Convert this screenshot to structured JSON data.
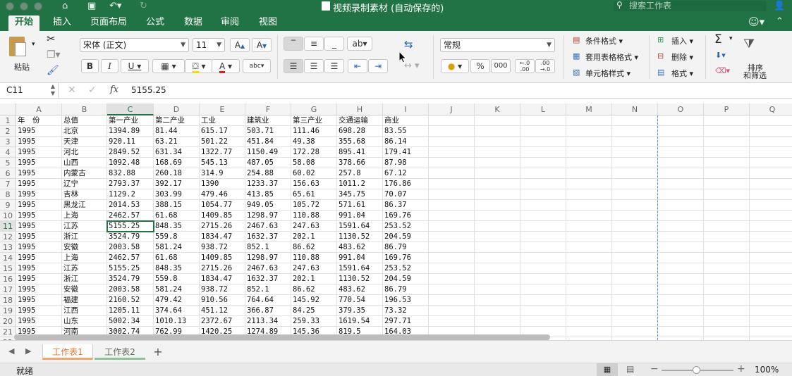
{
  "titlebar": {
    "title": "视频录制素材 (自动保存的)",
    "search_placeholder": "搜索工作表"
  },
  "ribbon_tabs": [
    "开始",
    "插入",
    "页面布局",
    "公式",
    "数据",
    "审阅",
    "视图"
  ],
  "active_tab": "开始",
  "ribbon": {
    "paste_label": "粘贴",
    "font_name": "宋体 (正文)",
    "font_size": "11",
    "bold": "B",
    "italic": "I",
    "underline": "U",
    "number_format": "常规",
    "percent": "%",
    "thousands": "000",
    "inc_decimal": "←.0 .00",
    "dec_decimal": ".00 →.0",
    "conditional_format": "条件格式",
    "format_as_table": "套用表格格式",
    "cell_styles": "单元格样式",
    "insert": "插入",
    "delete": "删除",
    "format": "格式",
    "sort_filter": "排序\n和筛选",
    "sort_filter_line1": "排序",
    "sort_filter_line2": "和筛选"
  },
  "formula_bar": {
    "name_box": "C11",
    "fx": "fx",
    "value": "5155.25"
  },
  "columns": [
    "A",
    "B",
    "C",
    "D",
    "E",
    "F",
    "G",
    "H",
    "I",
    "J",
    "K",
    "L",
    "M",
    "N",
    "O",
    "P",
    "Q"
  ],
  "selected_column": "C",
  "selected_row": 11,
  "header_row": [
    "年　份",
    "总值",
    "第一产业",
    "第二产业",
    "工业",
    "建筑业",
    "第三产业",
    "交通运输",
    "商业"
  ],
  "rows": [
    [
      "1995",
      "北京",
      "1394.89",
      "81.44",
      "615.17",
      "503.71",
      "111.46",
      "698.28",
      "83.55"
    ],
    [
      "1995",
      "天津",
      "920.11",
      "63.21",
      "501.22",
      "451.84",
      "49.38",
      "355.68",
      "86.14"
    ],
    [
      "1995",
      "河北",
      "2849.52",
      "631.34",
      "1322.77",
      "1150.49",
      "172.28",
      "895.41",
      "179.41"
    ],
    [
      "1995",
      "山西",
      "1092.48",
      "168.69",
      "545.13",
      "487.05",
      "58.08",
      "378.66",
      "87.98"
    ],
    [
      "1995",
      "内蒙古",
      "832.88",
      "260.18",
      "314.9",
      "254.88",
      "60.02",
      "257.8",
      "67.12"
    ],
    [
      "1995",
      "辽宁",
      "2793.37",
      "392.17",
      "1390",
      "1233.37",
      "156.63",
      "1011.2",
      "176.86"
    ],
    [
      "1995",
      "吉林",
      "1129.2",
      "303.99",
      "479.46",
      "413.85",
      "65.61",
      "345.75",
      "70.07"
    ],
    [
      "1995",
      "黑龙江",
      "2014.53",
      "388.15",
      "1054.77",
      "949.05",
      "105.72",
      "571.61",
      "86.37"
    ],
    [
      "1995",
      "上海",
      "2462.57",
      "61.68",
      "1409.85",
      "1298.97",
      "110.88",
      "991.04",
      "169.76"
    ],
    [
      "1995",
      "江苏",
      "5155.25",
      "848.35",
      "2715.26",
      "2467.63",
      "247.63",
      "1591.64",
      "253.52"
    ],
    [
      "1995",
      "浙江",
      "3524.79",
      "559.8",
      "1834.47",
      "1632.37",
      "202.1",
      "1130.52",
      "204.59"
    ],
    [
      "1995",
      "安徽",
      "2003.58",
      "581.24",
      "938.72",
      "852.1",
      "86.62",
      "483.62",
      "86.79"
    ],
    [
      "1995",
      "上海",
      "2462.57",
      "61.68",
      "1409.85",
      "1298.97",
      "110.88",
      "991.04",
      "169.76"
    ],
    [
      "1995",
      "江苏",
      "5155.25",
      "848.35",
      "2715.26",
      "2467.63",
      "247.63",
      "1591.64",
      "253.52"
    ],
    [
      "1995",
      "浙江",
      "3524.79",
      "559.8",
      "1834.47",
      "1632.37",
      "202.1",
      "1130.52",
      "204.59"
    ],
    [
      "1995",
      "安徽",
      "2003.58",
      "581.24",
      "938.72",
      "852.1",
      "86.62",
      "483.62",
      "86.79"
    ],
    [
      "1995",
      "福建",
      "2160.52",
      "479.42",
      "910.56",
      "764.64",
      "145.92",
      "770.54",
      "196.53"
    ],
    [
      "1995",
      "江西",
      "1205.11",
      "374.64",
      "451.12",
      "366.87",
      "84.25",
      "379.35",
      "73.32"
    ],
    [
      "1995",
      "山东",
      "5002.34",
      "1010.13",
      "2372.67",
      "2113.34",
      "259.33",
      "1619.54",
      "297.71"
    ],
    [
      "1995",
      "河南",
      "3002.74",
      "762.99",
      "1420.25",
      "1274.89",
      "145.36",
      "819.5",
      "164.03"
    ]
  ],
  "sheet_tabs": [
    "工作表1",
    "工作表2"
  ],
  "active_sheet": "工作表1",
  "add_sheet": "+",
  "status": {
    "ready": "就绪",
    "zoom": "100%",
    "zoom_level": 1.0
  },
  "colors": {
    "brand_green": "#217346",
    "active_tab_text": "#e8772e"
  }
}
